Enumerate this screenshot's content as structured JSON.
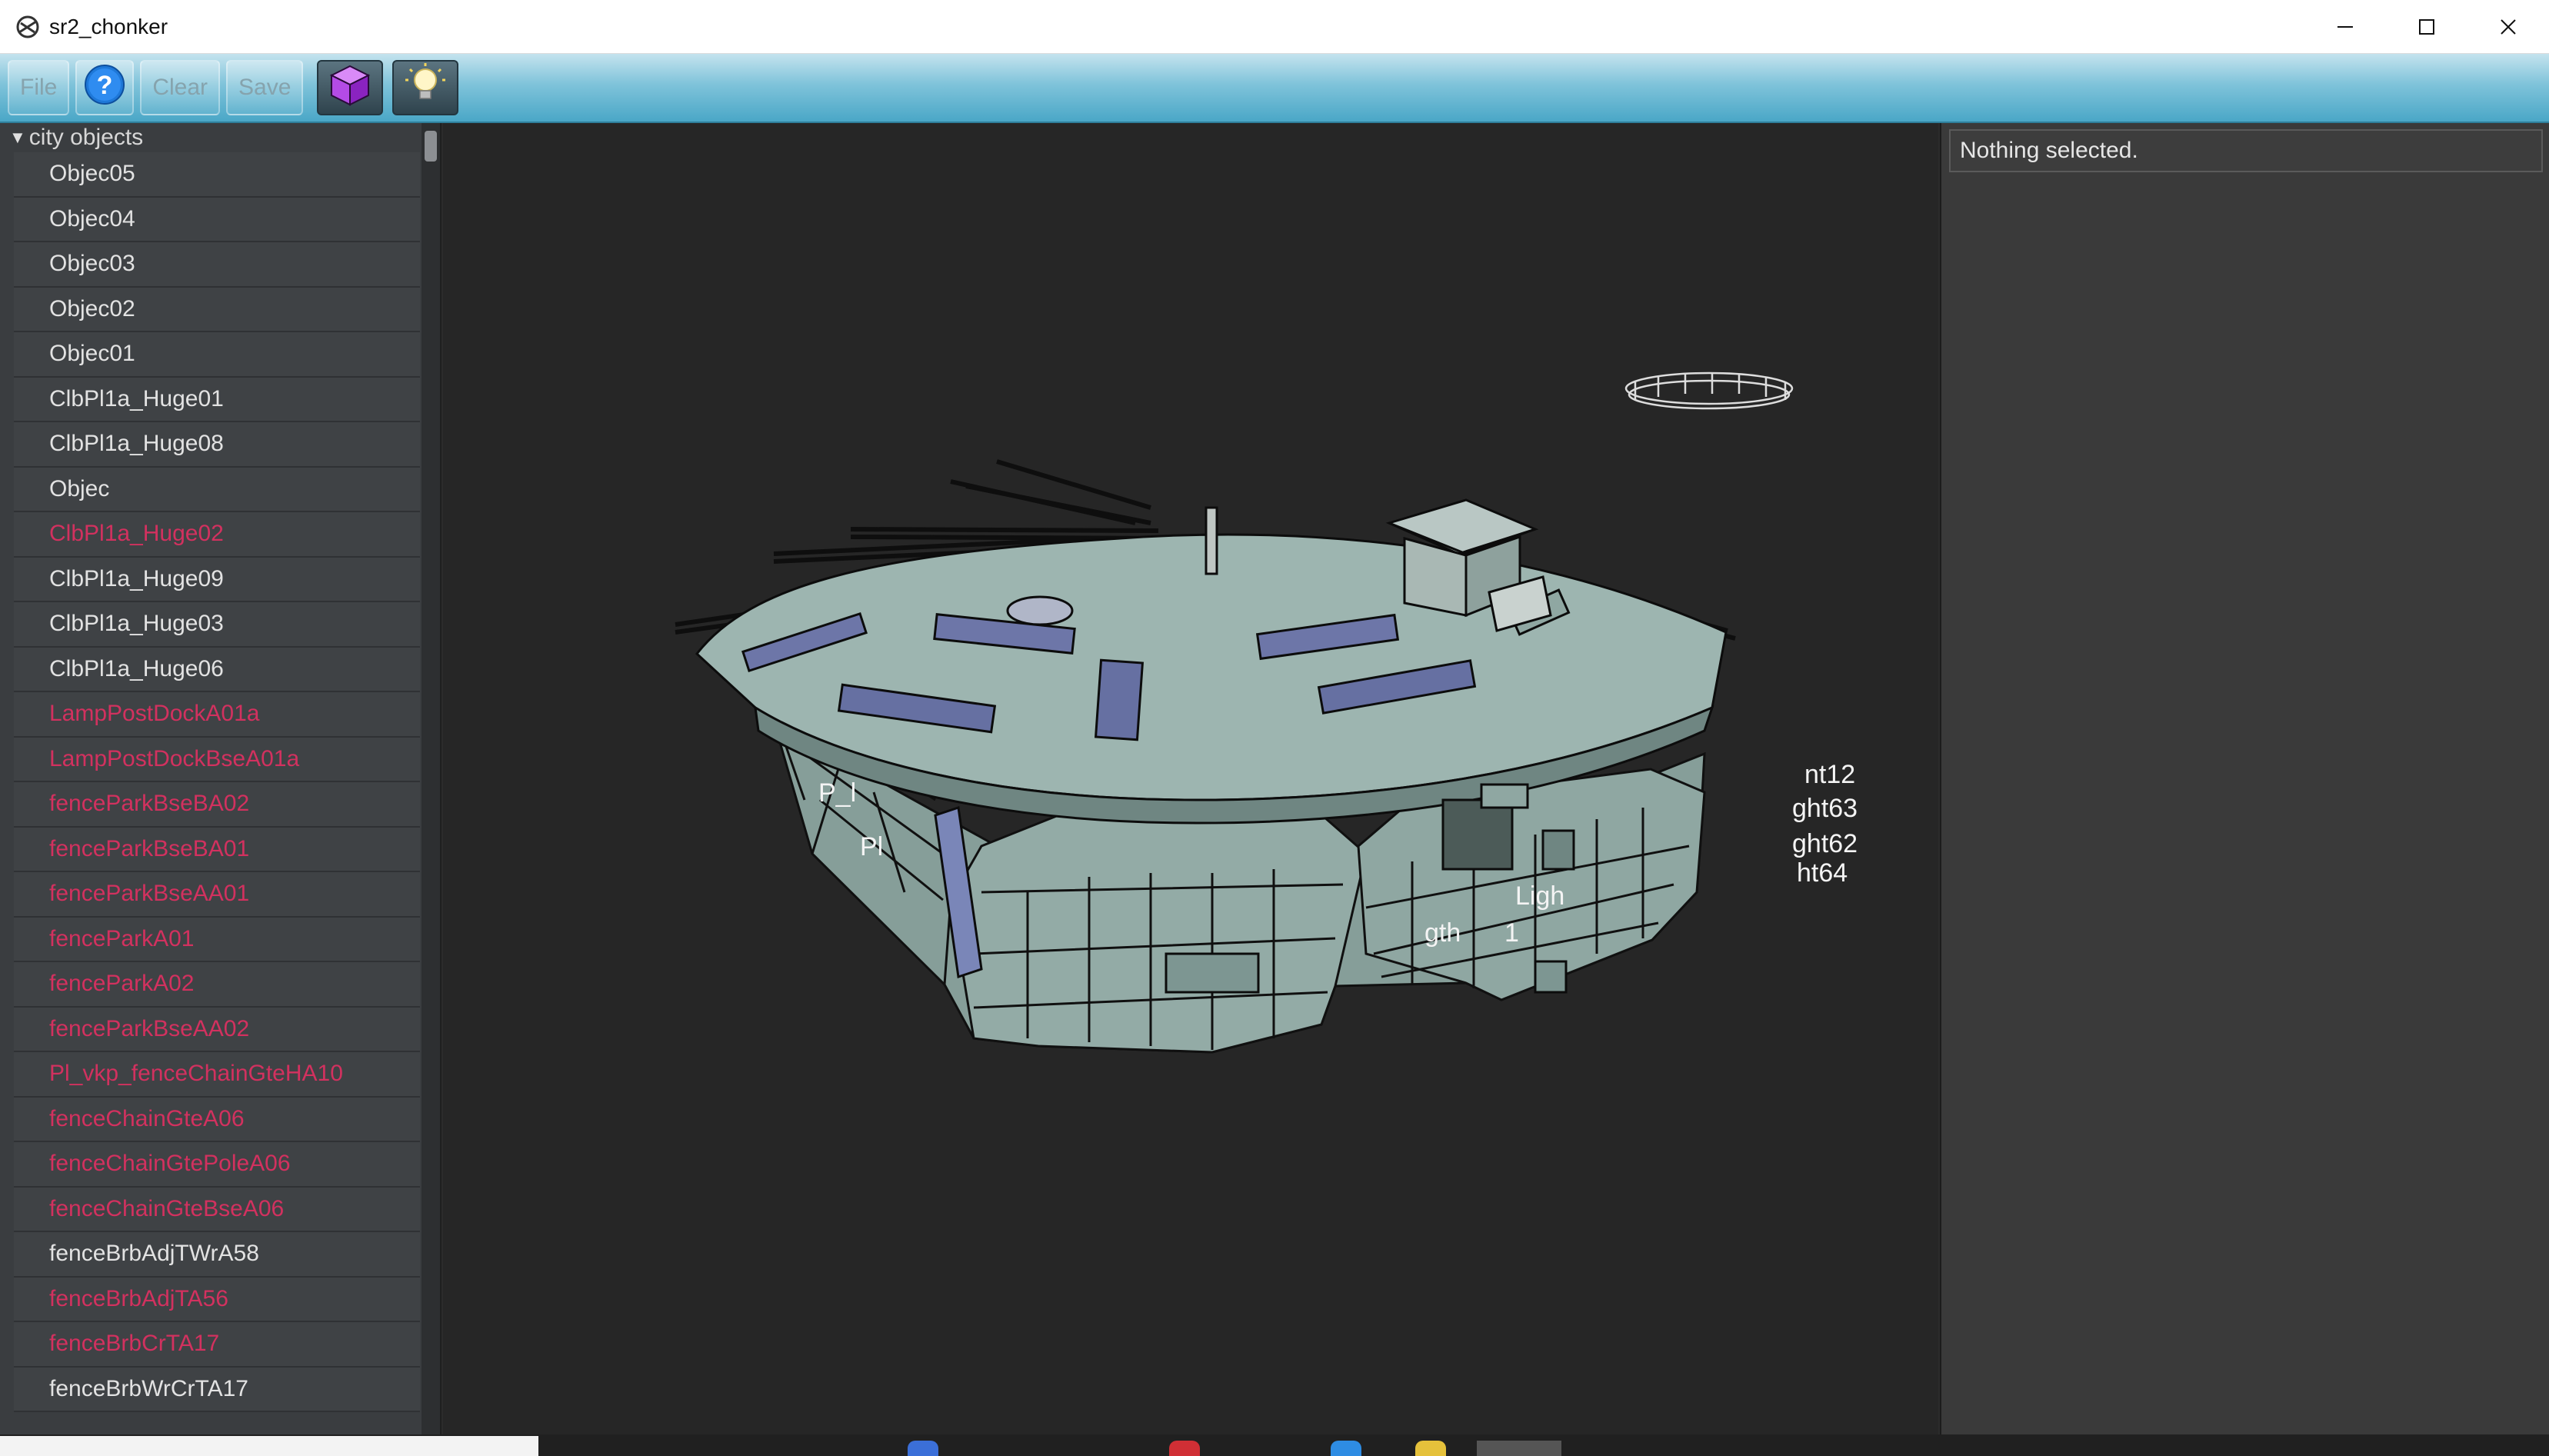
{
  "window": {
    "title": "sr2_chonker",
    "controls": [
      "minimize-icon",
      "maximize-icon",
      "close-icon"
    ]
  },
  "toolbar": {
    "file_label": "File",
    "help_icon": "help-icon",
    "clear_label": "Clear",
    "save_label": "Save",
    "cube_icon": "cube-icon",
    "light_icon": "lightbulb-icon"
  },
  "tree": {
    "root_label": "city objects",
    "items": [
      {
        "label": "Objec05",
        "red": false
      },
      {
        "label": "Objec04",
        "red": false
      },
      {
        "label": "Objec03",
        "red": false
      },
      {
        "label": "Objec02",
        "red": false
      },
      {
        "label": "Objec01",
        "red": false
      },
      {
        "label": "ClbPl1a_Huge01",
        "red": false
      },
      {
        "label": "ClbPl1a_Huge08",
        "red": false
      },
      {
        "label": "Objec",
        "red": false
      },
      {
        "label": "ClbPl1a_Huge02",
        "red": true
      },
      {
        "label": "ClbPl1a_Huge09",
        "red": false
      },
      {
        "label": "ClbPl1a_Huge03",
        "red": false
      },
      {
        "label": "ClbPl1a_Huge06",
        "red": false
      },
      {
        "label": "LampPostDockA01a",
        "red": true
      },
      {
        "label": "LampPostDockBseA01a",
        "red": true
      },
      {
        "label": "fenceParkBseBA02",
        "red": true
      },
      {
        "label": "fenceParkBseBA01",
        "red": true
      },
      {
        "label": "fenceParkBseAA01",
        "red": true
      },
      {
        "label": "fenceParkA01",
        "red": true
      },
      {
        "label": "fenceParkA02",
        "red": true
      },
      {
        "label": "fenceParkBseAA02",
        "red": true
      },
      {
        "label": "Pl_vkp_fenceChainGteHA10",
        "red": true
      },
      {
        "label": "fenceChainGteA06",
        "red": true
      },
      {
        "label": "fenceChainGtePoleA06",
        "red": true
      },
      {
        "label": "fenceChainGteBseA06",
        "red": true
      },
      {
        "label": "fenceBrbAdjTWrA58",
        "red": false
      },
      {
        "label": "fenceBrbAdjTA56",
        "red": true
      },
      {
        "label": "fenceBrbCrTA17",
        "red": true
      },
      {
        "label": "fenceBrbWrCrTA17",
        "red": false
      }
    ]
  },
  "viewport": {
    "labels": {
      "a": "nt12",
      "b": "ght63",
      "c": "ght62",
      "d": "ht64",
      "e": "P_l",
      "f": "Pl",
      "g": "Ligh",
      "h": "gth",
      "i": "1"
    }
  },
  "properties": {
    "selection_text": "Nothing selected."
  },
  "colors": {
    "toolbar_top": "#c4e3ee",
    "toolbar_bottom": "#4aa7c7",
    "tree_bg": "#3f4245",
    "tree_red": "#d2315f",
    "viewport_bg": "#262626",
    "model_fill": "#8fa8a3",
    "cube_purple": "#b44be6"
  }
}
